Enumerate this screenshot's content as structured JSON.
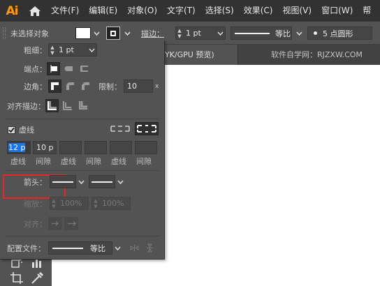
{
  "app": {
    "logo": "Ai"
  },
  "menu": {
    "items": [
      "文件(F)",
      "编辑(E)",
      "对象(O)",
      "文字(T)",
      "选择(S)",
      "效果(C)",
      "视图(V)",
      "窗口(W)",
      "帮"
    ]
  },
  "control_bar": {
    "selection": "未选择对象",
    "stroke_label": "描边：",
    "stroke_weight": "1 pt",
    "line_style": "等比",
    "brush": "5 点圆形"
  },
  "tabs": {
    "document": "YK/GPU 预览)",
    "watermark": "软件自学网：RJZXW.COM"
  },
  "stroke_panel": {
    "weight_label": "粗细：",
    "weight_value": "1 pt",
    "cap_label": "端点：",
    "corner_label": "边角：",
    "limit_label": "限制：",
    "limit_value": "10",
    "limit_unit": "x",
    "align_label": "对齐描边：",
    "dashed_label": "虚线",
    "dashed_checked": true,
    "dash_values": [
      "12 p",
      "10 p",
      "",
      "",
      "",
      ""
    ],
    "dash_labels": [
      "虚线",
      "间隙",
      "虚线",
      "间隙",
      "虚线",
      "间隙"
    ],
    "arrow_label": "箭头：",
    "scale_label": "缩放：",
    "scale_start": "100%",
    "scale_end": "100%",
    "align_arrow_label": "对齐：",
    "profile_label": "配置文件：",
    "profile_value": "等比"
  }
}
